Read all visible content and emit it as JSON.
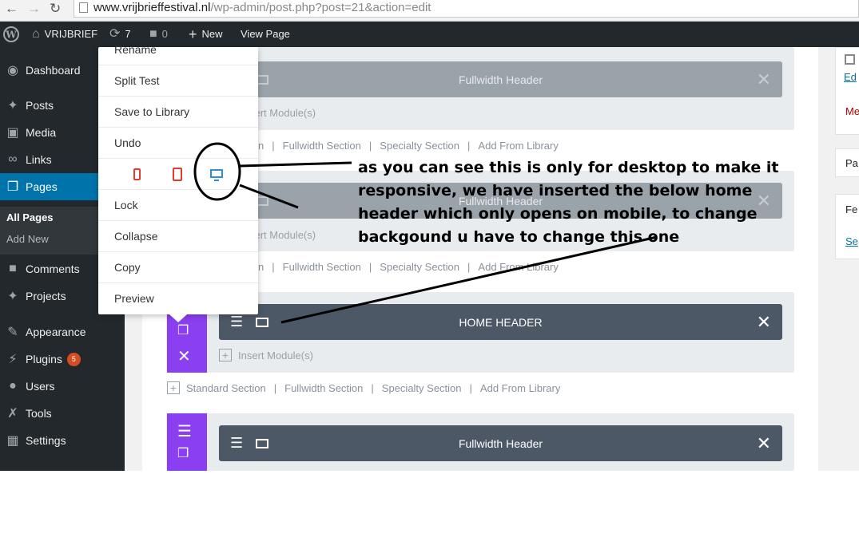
{
  "browser": {
    "url_host": "www.vrijbrieffestival.nl",
    "url_path": "/wp-admin/post.php?post=21&action=edit"
  },
  "adminbar": {
    "site_name": "VRIJBRIEF",
    "updates_count": "7",
    "comments_count": "0",
    "new_label": "New",
    "view_page_label": "View Page"
  },
  "sidebar": {
    "items": [
      {
        "label": "Dashboard",
        "icon": "dashboard-icon"
      },
      {
        "label": "Posts",
        "icon": "pin-icon"
      },
      {
        "label": "Media",
        "icon": "media-icon"
      },
      {
        "label": "Links",
        "icon": "link-icon"
      },
      {
        "label": "Pages",
        "icon": "pages-icon"
      },
      {
        "label": "Comments",
        "icon": "comment-icon"
      },
      {
        "label": "Projects",
        "icon": "pin-icon"
      },
      {
        "label": "Appearance",
        "icon": "brush-icon"
      },
      {
        "label": "Plugins",
        "icon": "plugin-icon",
        "badge": "5"
      },
      {
        "label": "Users",
        "icon": "user-icon"
      },
      {
        "label": "Tools",
        "icon": "wrench-icon"
      },
      {
        "label": "Settings",
        "icon": "settings-icon"
      }
    ],
    "pages_submenu": [
      "All Pages",
      "Add New"
    ]
  },
  "context_menu": {
    "items_top": [
      "Rename",
      "Split Test",
      "Save to Library",
      "Undo"
    ],
    "items_bottom": [
      "Lock",
      "Collapse",
      "Copy",
      "Preview"
    ],
    "device_icons": [
      "phone-icon",
      "tablet-icon",
      "desktop-icon"
    ]
  },
  "builder": {
    "row_titles": [
      "Fullwidth Header",
      "Fullwidth Header",
      "HOME HEADER",
      "Fullwidth Header"
    ],
    "insert_module_label": "Insert Module(s)",
    "insert_module_partial": "sert Module(s)",
    "add_links": [
      "Standard Section",
      "Fullwidth Section",
      "Specialty Section",
      "Add From Library"
    ],
    "add_links_partial_first": "n"
  },
  "right_panel": {
    "labels": [
      "Ed",
      "Me",
      "Pa",
      "Fe",
      "Se"
    ]
  },
  "annotation": {
    "text": "as you can see this is only for desktop to make it responsive, we have inserted the below home header which only opens on mobile, to change backgound u have to change this one"
  },
  "colors": {
    "admin_dark": "#23282d",
    "admin_active": "#0073aa",
    "divi_purple": "#8a3ff0",
    "row_dark": "#4c5866",
    "row_faded": "#9aa2aa",
    "plugin_badge": "#d54e21"
  }
}
